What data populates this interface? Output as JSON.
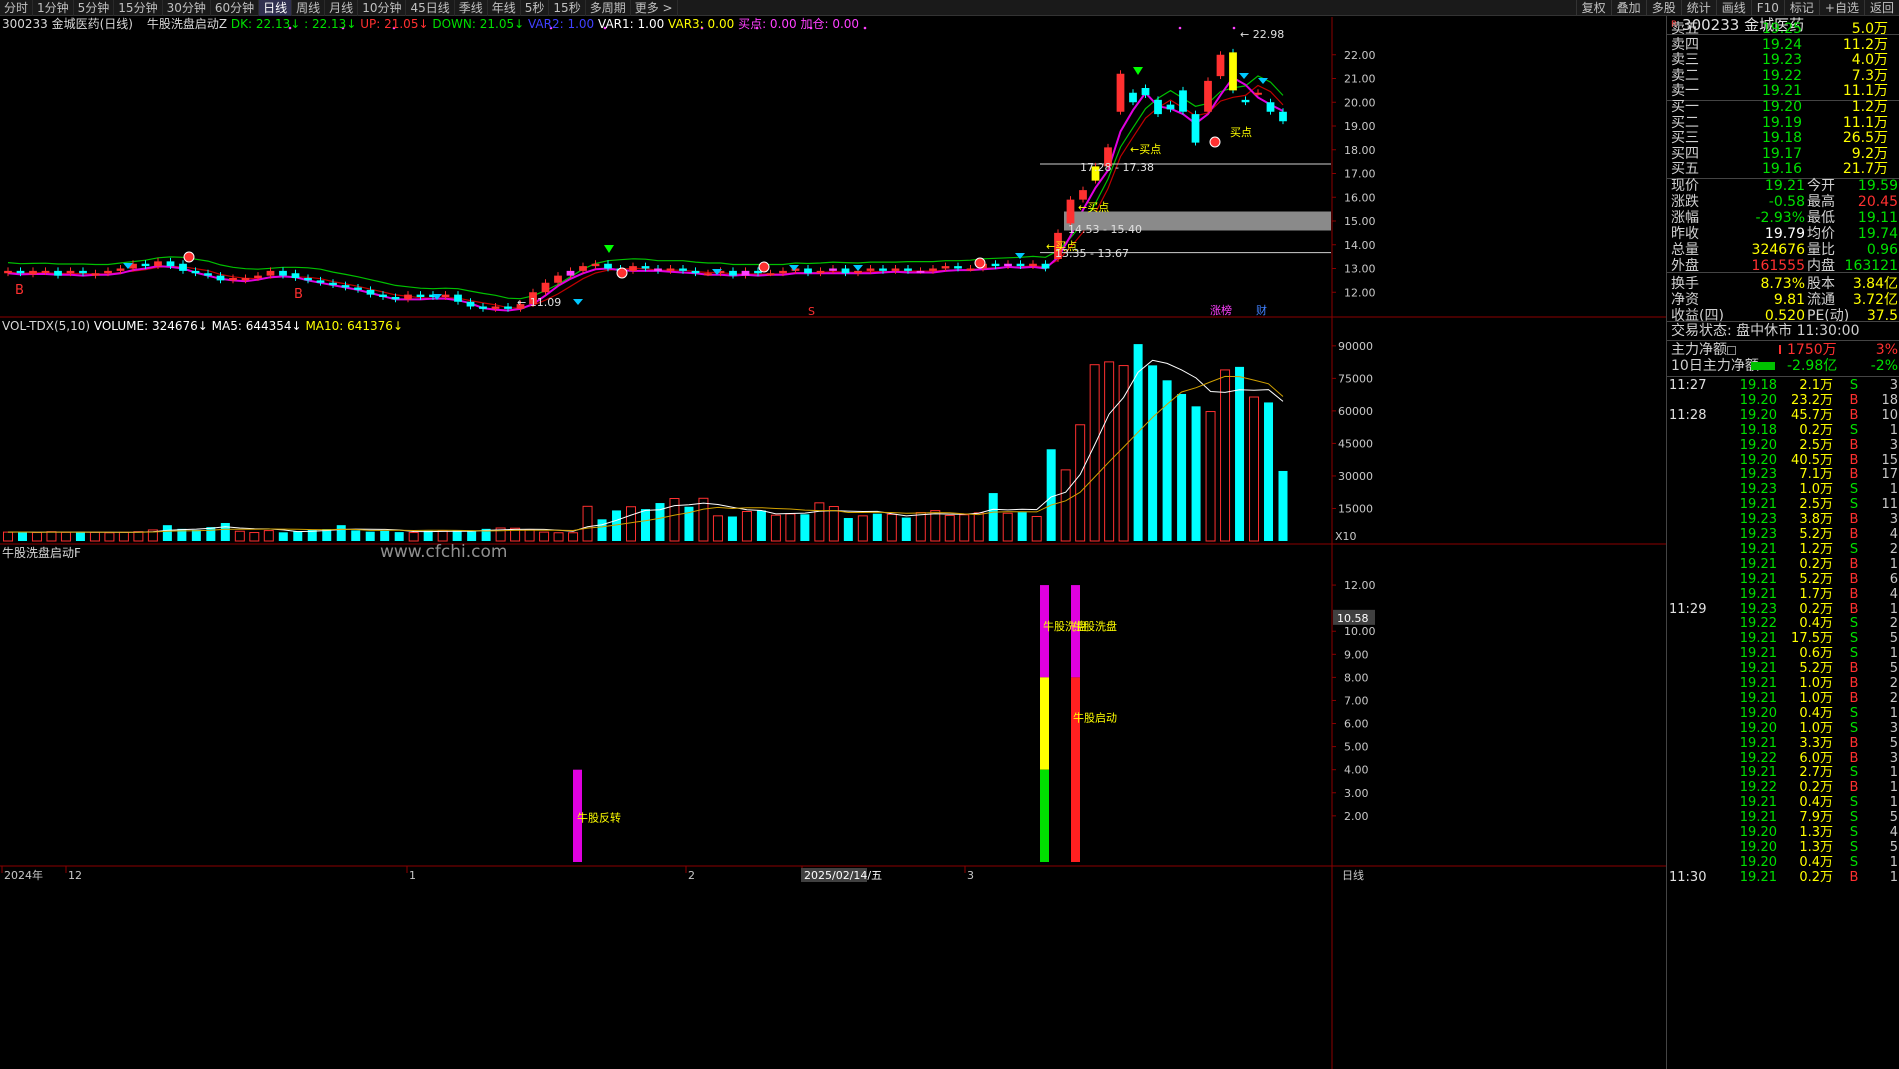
{
  "toolbar": {
    "periods": [
      "分时",
      "1分钟",
      "5分钟",
      "15分钟",
      "30分钟",
      "60分钟",
      "日线",
      "周线",
      "月线",
      "10分钟",
      "45日线",
      "季线",
      "年线",
      "5秒",
      "15秒",
      "多周期",
      "更多 >"
    ],
    "active_period": "日线",
    "right_tools": [
      "复权",
      "叠加",
      "多股",
      "统计",
      "画线",
      "F10",
      "标记",
      "+自选",
      "返回"
    ]
  },
  "main_info": {
    "title": "300233 金城医药(日线)",
    "indicator": "牛股洗盘启动Z",
    "dk": "DK: 22.13",
    "dk2": ": 22.13",
    "up": "UP: 21.05",
    "down": "DOWN: 21.05",
    "var2": "VAR2: 1.00",
    "var1": "VAR1: 1.00",
    "var3": "VAR3: 0.00",
    "buy": "买点: 0.00",
    "add": "加仓: 0.00"
  },
  "main_labels": {
    "high": "22.98",
    "low": "11.09",
    "buy_points": [
      "←买点",
      "←买点",
      "←买点",
      "买点"
    ],
    "zone1": "17.28 - 17.38",
    "zone2": "14.53 - 15.40",
    "zone3": "13.35 - 13.67",
    "b_marks": [
      "B",
      "B"
    ],
    "s_mark": "S",
    "zt": "涨榜",
    "cai": "财"
  },
  "price_axis": [
    "22.00",
    "21.00",
    "20.00",
    "19.00",
    "18.00",
    "17.00",
    "16.00",
    "15.00",
    "14.00",
    "13.00",
    "12.00"
  ],
  "vol_info": {
    "name": "VOL-TDX(5,10)",
    "volume": "VOLUME: 324676",
    "ma5": "MA5: 644354",
    "ma10": "MA10: 641376"
  },
  "vol_axis": [
    "90000",
    "75000",
    "60000",
    "45000",
    "30000",
    "15000"
  ],
  "vol_unit": "X10",
  "ind_info": {
    "name": "牛股洗盘启动F"
  },
  "ind_labels": {
    "reverse": "牛股反转",
    "wash1": "牛股洗盘",
    "wash2": "牛股洗盘",
    "start": "牛股启动"
  },
  "watermark": "www.cfchi.com",
  "ind_axis": [
    "12.00",
    "10.00",
    "9.00",
    "8.00",
    "7.00",
    "6.00",
    "5.00",
    "4.00",
    "3.00",
    "2.00"
  ],
  "ind_current": "10.58",
  "date_axis": [
    "2024年",
    "12",
    "1",
    "2",
    "2025/02/14/五",
    "3"
  ],
  "bottom_period": "日线",
  "side": {
    "code": "300233",
    "name": "金城医药",
    "sell": [
      {
        "label": "卖五",
        "price": "19.25",
        "vol": "5.0万"
      },
      {
        "label": "卖四",
        "price": "19.24",
        "vol": "11.2万"
      },
      {
        "label": "卖三",
        "price": "19.23",
        "vol": "4.0万"
      },
      {
        "label": "卖二",
        "price": "19.22",
        "vol": "7.3万"
      },
      {
        "label": "卖一",
        "price": "19.21",
        "vol": "11.1万"
      }
    ],
    "buy": [
      {
        "label": "买一",
        "price": "19.20",
        "vol": "1.2万"
      },
      {
        "label": "买二",
        "price": "19.19",
        "vol": "11.1万"
      },
      {
        "label": "买三",
        "price": "19.18",
        "vol": "26.5万"
      },
      {
        "label": "买四",
        "price": "19.17",
        "vol": "9.2万"
      },
      {
        "label": "买五",
        "price": "19.16",
        "vol": "21.7万"
      }
    ],
    "stats": [
      {
        "l1": "现价",
        "v1": "19.21",
        "c1": "green",
        "l2": "今开",
        "v2": "19.59",
        "c2": "green"
      },
      {
        "l1": "涨跌",
        "v1": "-0.58",
        "c1": "green",
        "l2": "最高",
        "v2": "20.45",
        "c2": "red"
      },
      {
        "l1": "涨幅",
        "v1": "-2.93%",
        "c1": "green",
        "l2": "最低",
        "v2": "19.11",
        "c2": "green"
      },
      {
        "l1": "昨收",
        "v1": "19.79",
        "c1": "white",
        "l2": "均价",
        "v2": "19.74",
        "c2": "green"
      },
      {
        "l1": "总量",
        "v1": "324676",
        "c1": "yellow",
        "l2": "量比",
        "v2": "0.96",
        "c2": "green"
      },
      {
        "l1": "外盘",
        "v1": "161555",
        "c1": "red",
        "l2": "内盘",
        "v2": "163121",
        "c2": "green"
      },
      {
        "l1": "换手",
        "v1": "8.73%",
        "c1": "yellow",
        "l2": "股本",
        "v2": "3.84亿",
        "c2": "yellow"
      },
      {
        "l1": "净资",
        "v1": "9.81",
        "c1": "yellow",
        "l2": "流通",
        "v2": "3.72亿",
        "c2": "yellow"
      },
      {
        "l1": "收益(四)",
        "v1": "0.520",
        "c1": "yellow",
        "l2": "PE(动)",
        "v2": "37.5",
        "c2": "yellow"
      }
    ],
    "status": "交易状态: 盘中休市 11:30:00",
    "main_flow_label": "主力净额",
    "main_flow_value": "1750万",
    "main_flow_pct": "3%",
    "flow10_label": "10日主力净额",
    "flow10_value": "-2.98亿",
    "flow10_pct": "-2%",
    "ticks": [
      {
        "t": "11:27",
        "p": "19.18",
        "v": "2.1万",
        "d": "S",
        "n": "3"
      },
      {
        "t": "",
        "p": "19.20",
        "v": "23.2万",
        "d": "B",
        "n": "18"
      },
      {
        "t": "11:28",
        "p": "19.20",
        "v": "45.7万",
        "d": "B",
        "n": "10"
      },
      {
        "t": "",
        "p": "19.18",
        "v": "0.2万",
        "d": "S",
        "n": "1"
      },
      {
        "t": "",
        "p": "19.20",
        "v": "2.5万",
        "d": "B",
        "n": "3"
      },
      {
        "t": "",
        "p": "19.20",
        "v": "40.5万",
        "d": "B",
        "n": "15"
      },
      {
        "t": "",
        "p": "19.23",
        "v": "7.1万",
        "d": "B",
        "n": "17"
      },
      {
        "t": "",
        "p": "19.23",
        "v": "1.0万",
        "d": "S",
        "n": "1"
      },
      {
        "t": "",
        "p": "19.21",
        "v": "2.5万",
        "d": "S",
        "n": "11"
      },
      {
        "t": "",
        "p": "19.23",
        "v": "3.8万",
        "d": "B",
        "n": "3"
      },
      {
        "t": "",
        "p": "19.23",
        "v": "5.2万",
        "d": "B",
        "n": "4"
      },
      {
        "t": "",
        "p": "19.21",
        "v": "1.2万",
        "d": "S",
        "n": "2"
      },
      {
        "t": "",
        "p": "19.21",
        "v": "0.2万",
        "d": "B",
        "n": "1"
      },
      {
        "t": "",
        "p": "19.21",
        "v": "5.2万",
        "d": "B",
        "n": "6"
      },
      {
        "t": "",
        "p": "19.21",
        "v": "1.7万",
        "d": "B",
        "n": "4"
      },
      {
        "t": "11:29",
        "p": "19.23",
        "v": "0.2万",
        "d": "B",
        "n": "1"
      },
      {
        "t": "",
        "p": "19.22",
        "v": "0.4万",
        "d": "S",
        "n": "2"
      },
      {
        "t": "",
        "p": "19.21",
        "v": "17.5万",
        "d": "S",
        "n": "5"
      },
      {
        "t": "",
        "p": "19.21",
        "v": "0.6万",
        "d": "S",
        "n": "1"
      },
      {
        "t": "",
        "p": "19.21",
        "v": "5.2万",
        "d": "B",
        "n": "5"
      },
      {
        "t": "",
        "p": "19.21",
        "v": "1.0万",
        "d": "B",
        "n": "2"
      },
      {
        "t": "",
        "p": "19.21",
        "v": "1.0万",
        "d": "B",
        "n": "2"
      },
      {
        "t": "",
        "p": "19.20",
        "v": "0.4万",
        "d": "S",
        "n": "1"
      },
      {
        "t": "",
        "p": "19.20",
        "v": "1.0万",
        "d": "S",
        "n": "3"
      },
      {
        "t": "",
        "p": "19.21",
        "v": "3.3万",
        "d": "B",
        "n": "5"
      },
      {
        "t": "",
        "p": "19.22",
        "v": "6.0万",
        "d": "B",
        "n": "3"
      },
      {
        "t": "",
        "p": "19.21",
        "v": "2.7万",
        "d": "S",
        "n": "1"
      },
      {
        "t": "",
        "p": "19.22",
        "v": "0.2万",
        "d": "B",
        "n": "1"
      },
      {
        "t": "",
        "p": "19.21",
        "v": "0.4万",
        "d": "S",
        "n": "1"
      },
      {
        "t": "",
        "p": "19.21",
        "v": "7.9万",
        "d": "S",
        "n": "5"
      },
      {
        "t": "",
        "p": "19.20",
        "v": "1.3万",
        "d": "S",
        "n": "4"
      },
      {
        "t": "",
        "p": "19.20",
        "v": "1.3万",
        "d": "S",
        "n": "5"
      },
      {
        "t": "",
        "p": "19.20",
        "v": "0.4万",
        "d": "S",
        "n": "1"
      },
      {
        "t": "11:30",
        "p": "19.21",
        "v": "0.2万",
        "d": "B",
        "n": "1"
      }
    ]
  },
  "colors": {
    "up": "#ff3030",
    "down": "#00ffff",
    "bg": "#000000",
    "grid": "#3a0000"
  },
  "chart_data": {
    "type": "candlestick",
    "ohlc_open": [
      12.8,
      12.9,
      12.75,
      12.85,
      12.9,
      12.8,
      12.9,
      12.7,
      12.8,
      12.9,
      13.0,
      13.2,
      13.1,
      13.3,
      13.2,
      12.9,
      12.8,
      12.7,
      12.5,
      12.5,
      12.6,
      12.7,
      12.9,
      12.8,
      12.6,
      12.5,
      12.4,
      12.3,
      12.2,
      12.1,
      11.9,
      11.8,
      11.7,
      11.9,
      11.9,
      11.8,
      11.9,
      11.6,
      11.4,
      11.3,
      11.4,
      11.3,
      11.5,
      12.0,
      12.4,
      12.7,
      12.9,
      13.1,
      13.2,
      13.0,
      12.9,
      13.1,
      13.0,
      12.9,
      13.0,
      12.9,
      12.8,
      12.8,
      12.9,
      12.7,
      12.9,
      12.8,
      12.8,
      12.9,
      13.0,
      12.8,
      12.9,
      13.0,
      12.8,
      12.9,
      13.0,
      12.9,
      13.0,
      12.9,
      12.9,
      13.0,
      13.1,
      13.0,
      13.0,
      13.2,
      13.1,
      13.2,
      13.1,
      13.2,
      13.4,
      14.9,
      15.9,
      16.7,
      17.3,
      19.6,
      20.4,
      20.6,
      20.1,
      19.9,
      20.5,
      19.5,
      19.6,
      21.1,
      22.1,
      20.1,
      20.4,
      20.0,
      19.6
    ],
    "ohlc_close": [
      12.9,
      12.8,
      12.9,
      12.9,
      12.7,
      12.9,
      12.8,
      12.8,
      12.9,
      13.0,
      13.2,
      13.1,
      13.3,
      13.1,
      12.9,
      12.8,
      12.7,
      12.5,
      12.6,
      12.6,
      12.7,
      12.9,
      12.7,
      12.6,
      12.5,
      12.4,
      12.3,
      12.2,
      12.1,
      11.9,
      11.8,
      11.7,
      11.9,
      11.8,
      11.8,
      11.9,
      11.6,
      11.4,
      11.3,
      11.4,
      11.3,
      11.5,
      12.0,
      12.4,
      12.7,
      12.9,
      13.1,
      13.2,
      13.0,
      12.9,
      13.1,
      13.0,
      12.9,
      13.0,
      12.9,
      12.8,
      12.8,
      12.9,
      12.7,
      12.9,
      12.8,
      12.8,
      12.9,
      13.0,
      12.8,
      12.9,
      13.0,
      12.8,
      12.9,
      13.0,
      12.9,
      13.0,
      12.9,
      12.9,
      13.0,
      13.1,
      13.0,
      13.0,
      13.2,
      13.1,
      13.2,
      13.1,
      13.2,
      13.0,
      14.5,
      15.9,
      16.3,
      17.3,
      18.1,
      21.2,
      20.0,
      20.3,
      19.5,
      19.7,
      19.6,
      18.3,
      20.9,
      22.0,
      20.5,
      20.0,
      20.4,
      19.6,
      19.2
    ],
    "price_range": [
      11.0,
      23.0
    ],
    "volume_x10": [
      4100,
      4200,
      3900,
      4300,
      4000,
      4100,
      4000,
      3800,
      4000,
      4300,
      5100,
      7300,
      5600,
      5100,
      6400,
      8300,
      4500,
      3900,
      4800,
      4000,
      4500,
      5300,
      5500,
      7300,
      4900,
      4300,
      4700,
      4100,
      3900,
      4700,
      4800,
      4800,
      4500,
      5600,
      6000,
      5900,
      5100,
      4100,
      3800,
      3800,
      16000,
      10000,
      14100,
      15800,
      14700,
      17500,
      19600,
      15800,
      19700,
      11600,
      11300,
      13600,
      14100,
      11900,
      12500,
      12300,
      17600,
      15900,
      10600,
      11600,
      12600,
      12300,
      10800,
      13100,
      14000,
      11800,
      12100,
      13000,
      22100,
      12800,
      13300,
      11300,
      42300,
      32800,
      53600,
      81300,
      82600,
      80900,
      90800,
      81000,
      74100,
      67800,
      62100,
      59700,
      78900,
      80300,
      66400,
      63900,
      32300
    ],
    "ma5_x10": 64435.4,
    "ma10_x10": 64137.6,
    "indicator_bars": [
      {
        "label": "牛股反转",
        "value": 4.0
      },
      {
        "label": "牛股洗盘",
        "value": 12.0
      },
      {
        "label": "牛股洗盘 / 牛股启动",
        "value": 12.0
      }
    ]
  }
}
